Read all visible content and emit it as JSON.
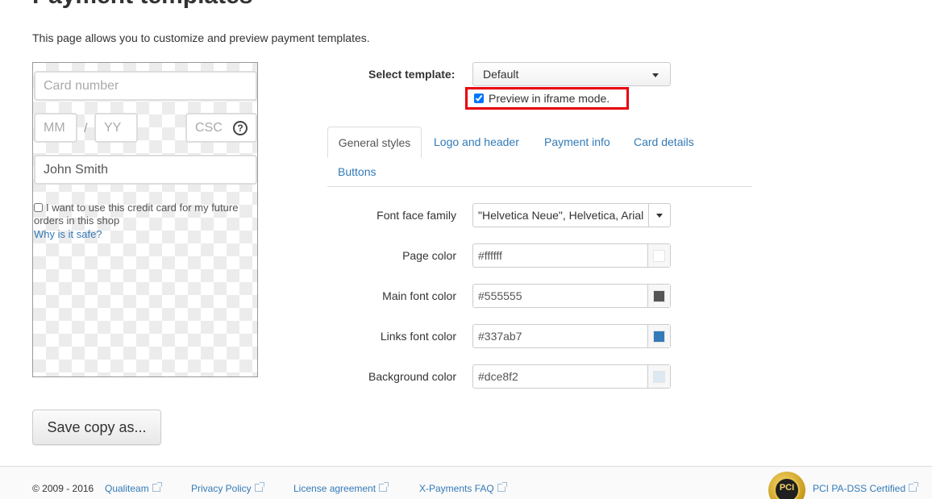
{
  "page": {
    "title": "Payment templates",
    "intro": "This page allows you to customize and preview payment templates."
  },
  "preview": {
    "card_number_placeholder": "Card number",
    "mm_placeholder": "MM",
    "slash": "/",
    "yy_placeholder": "YY",
    "csc_placeholder": "CSC",
    "help": "?",
    "cardholder_name": "John Smith",
    "save_card_label": "I want to use this credit card for my future orders in this shop",
    "save_card_checked": false,
    "why_safe_link": "Why is it safe?"
  },
  "actions": {
    "save_copy_label": "Save copy as..."
  },
  "template": {
    "select_label": "Select template:",
    "selected": "Default",
    "iframe_label": "Preview in iframe mode.",
    "iframe_checked": true
  },
  "tabs": [
    {
      "label": "General styles",
      "active": true
    },
    {
      "label": "Logo and header",
      "active": false
    },
    {
      "label": "Payment info",
      "active": false
    },
    {
      "label": "Card details",
      "active": false
    },
    {
      "label": "Buttons",
      "active": false
    }
  ],
  "styles": {
    "font_face_label": "Font face family",
    "font_face_value": "\"Helvetica Neue\", Helvetica, Arial",
    "page_color_label": "Page color",
    "page_color_value": "#ffffff",
    "main_font_color_label": "Main font color",
    "main_font_color_value": "#555555",
    "links_font_color_label": "Links font color",
    "links_font_color_value": "#337ab7",
    "background_color_label": "Background color",
    "background_color_value": "#dce8f2"
  },
  "colors": {
    "accent_link": "#337ab7",
    "highlight_border": "#e8000b"
  },
  "footer": {
    "copyright": "© 2009 - 2016",
    "links": [
      "Qualiteam",
      "Privacy Policy",
      "License agreement",
      "X-Payments FAQ"
    ],
    "pci_badge_text": "PCI",
    "pci_link": "PCI PA-DSS Certified"
  }
}
